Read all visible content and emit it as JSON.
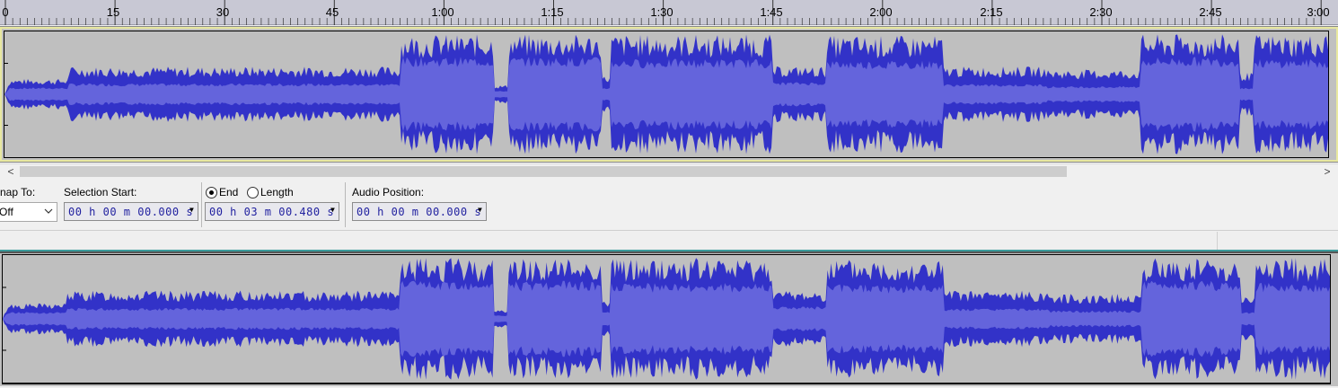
{
  "timeline": {
    "labels": [
      "0",
      "15",
      "30",
      "45",
      "1:00",
      "1:15",
      "1:30",
      "1:45",
      "2:00",
      "2:15",
      "2:30",
      "2:45",
      "3:00"
    ]
  },
  "scrollbar": {
    "left_arrow": "<",
    "right_arrow": ">"
  },
  "toolbar": {
    "snap_to_label": "nap To:",
    "snap_to_value": "Off",
    "selection_start_label": "Selection Start:",
    "end_label": "End",
    "length_label": "Length",
    "end_selected": true,
    "audio_position_label": "Audio Position:",
    "selection_start_value": "00 h 00 m 00.000 s",
    "end_value": "00 h 03 m 00.480 s",
    "audio_position_value": "00 h 00 m 00.000 s"
  },
  "colors": {
    "waveform": "#3232c8",
    "waveform_rms": "#6464dc",
    "track_bg": "#c0c0c0",
    "ruler_bg": "#c8c8d4"
  }
}
